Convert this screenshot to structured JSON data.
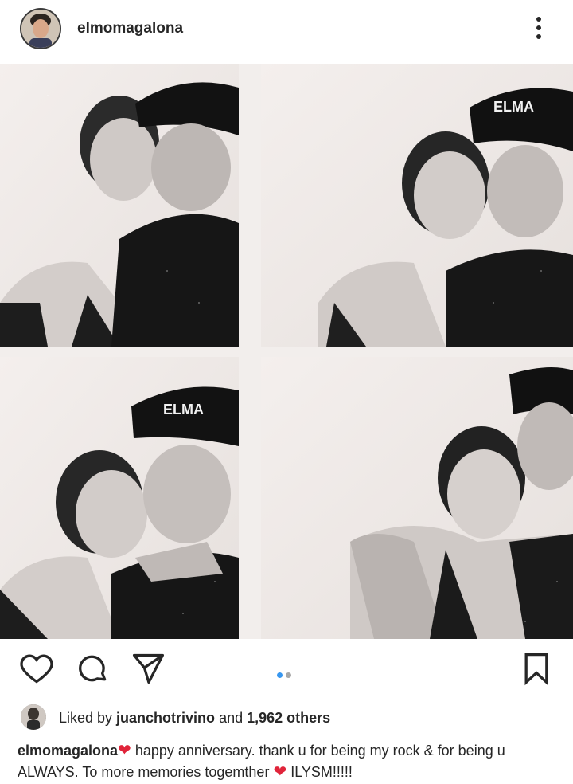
{
  "post": {
    "username": "elmomagalona",
    "more_icon": "more-vertical-icon",
    "photo": {
      "alt": "photobooth collage",
      "carousel_dots": 2,
      "active_index": 0
    },
    "actions": {
      "like_icon": "heart-icon",
      "comment_icon": "comment-icon",
      "share_icon": "send-icon",
      "save_icon": "bookmark-icon"
    },
    "likes": {
      "prefix": "Liked by ",
      "user": "juanchotrivino",
      "middle": " and ",
      "count": "1,962 others"
    },
    "caption": {
      "username": "elmomagalona",
      "text_part1": " happy anniversary. thank u for being my rock & for being u ALWAYS. To more memories togemther ",
      "text_part2": " ILYSM!!!!!",
      "emoji": "❤"
    }
  },
  "colors": {
    "accent_blue": "#3897f0",
    "heart_red": "#e0243a",
    "text": "#262626"
  }
}
